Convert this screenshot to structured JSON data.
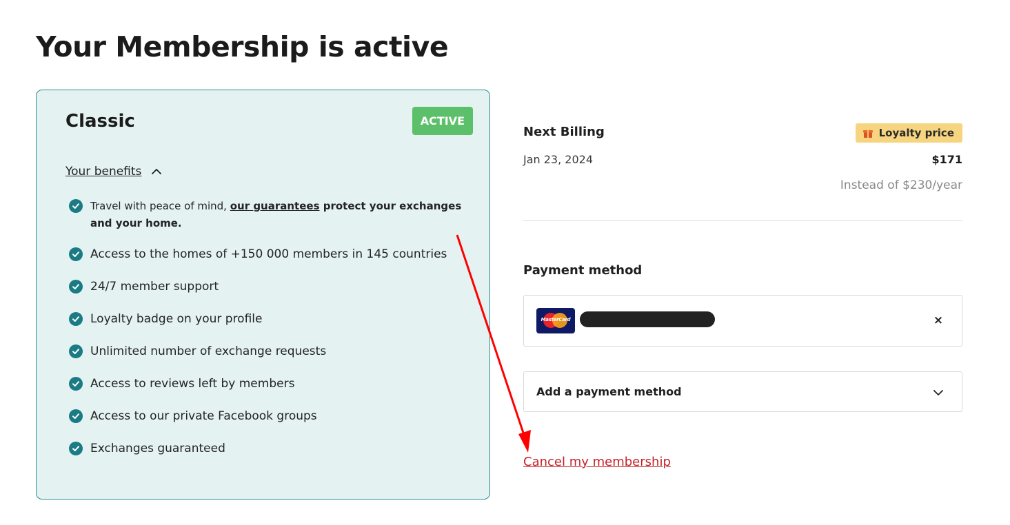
{
  "page": {
    "title": "Your Membership is active"
  },
  "plan": {
    "name": "Classic",
    "status": "ACTIVE",
    "benefits_toggle_label": "Your benefits",
    "first_benefit": {
      "prefix": "Travel with peace of mind, ",
      "link": "our guarantees",
      "suffix": " protect your exchanges and your home."
    },
    "benefits": [
      "Access to the homes of +150 000 members in 145 countries",
      "24/7 member support",
      "Loyalty badge on your profile",
      "Unlimited number of exchange requests",
      "Access to reviews left by members",
      "Access to our private Facebook groups",
      "Exchanges guaranteed"
    ]
  },
  "billing": {
    "title": "Next Billing",
    "loyalty_badge": "Loyalty price",
    "date": "Jan 23, 2024",
    "price": "$171",
    "instead": "Instead of $230/year"
  },
  "payment": {
    "title": "Payment method",
    "card_brand_text": "MasterCard",
    "remove_label": "×",
    "add_label": "Add a payment method"
  },
  "cancel": {
    "label": "Cancel my membership"
  },
  "colors": {
    "card_bg": "#e4f2f2",
    "card_border": "#2c8b93",
    "active_badge": "#5cc06a",
    "check_icon": "#1b7b85",
    "loyalty_badge": "#f7d580",
    "cancel_link": "#c42027",
    "annotation_arrow": "#ff0000"
  }
}
